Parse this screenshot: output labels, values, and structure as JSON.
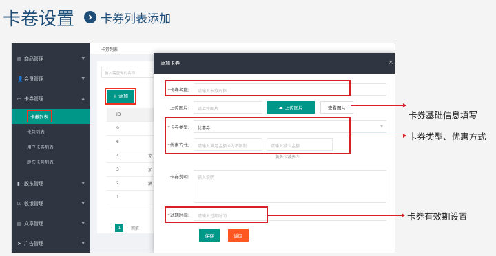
{
  "slide": {
    "title": "卡卷设置",
    "subtitle": "卡券列表添加"
  },
  "sidebar": {
    "items": [
      {
        "icon": "bar-chart-icon",
        "label": "商品管理"
      },
      {
        "icon": "user-icon",
        "label": "会员管理"
      },
      {
        "icon": "card-icon",
        "label": "卡券管理"
      }
    ],
    "sub_items": [
      {
        "label": "卡券列表",
        "active": true
      },
      {
        "label": "卡包列表"
      },
      {
        "label": "用户卡券列表"
      },
      {
        "label": "股东卡包列表"
      }
    ],
    "items_bottom": [
      {
        "icon": "bookmark-icon",
        "label": "股东管理"
      },
      {
        "icon": "check-icon",
        "label": "收银管理"
      },
      {
        "icon": "doc-icon",
        "label": "文章管理"
      },
      {
        "icon": "send-icon",
        "label": "广告管理"
      }
    ]
  },
  "list_page": {
    "tab": "卡券列表",
    "search_placeholder": "输入需查询的名称",
    "add_button": "+ 添加",
    "table_header": "ID",
    "rows": [
      {
        "id": "9",
        "extra": ""
      },
      {
        "id": "6",
        "extra": ""
      },
      {
        "id": "4",
        "extra": "充"
      },
      {
        "id": "3",
        "extra": "加"
      },
      {
        "id": "2",
        "extra": "满"
      },
      {
        "id": "1",
        "extra": ""
      }
    ],
    "pager_page": "1",
    "pager_label": "到第"
  },
  "modal": {
    "title": "添加卡券",
    "close": "×",
    "name_label": "*卡券名称:",
    "name_placeholder": "请输入卡券名称",
    "image_label": "上传图片:",
    "image_placeholder": "请上传图片",
    "upload_button": "上传图片",
    "view_button": "查看图片",
    "type_label": "*卡券类型:",
    "type_value": "优惠券",
    "discount_label": "*优惠方式:",
    "discount_placeholder_1": "请输入满足金额 0为不限制",
    "discount_placeholder_2": "请输入减少金额",
    "discount_hint": "满多少减多少",
    "desc_label": "卡券说明:",
    "desc_placeholder": "输入说明",
    "expire_label": "*过期时间:",
    "expire_placeholder": "请输入过期时间",
    "save_button": "保存",
    "back_button": "返回"
  },
  "callouts": [
    {
      "text": "卡券基础信息填写"
    },
    {
      "text": "卡券类型、优惠方式"
    },
    {
      "text": "卡券有效期设置"
    }
  ],
  "colors": {
    "title": "#1f4e79",
    "sidebar_bg": "#2f3541",
    "accent": "#009688",
    "danger": "#ff5722",
    "annotation": "#d61f26"
  }
}
